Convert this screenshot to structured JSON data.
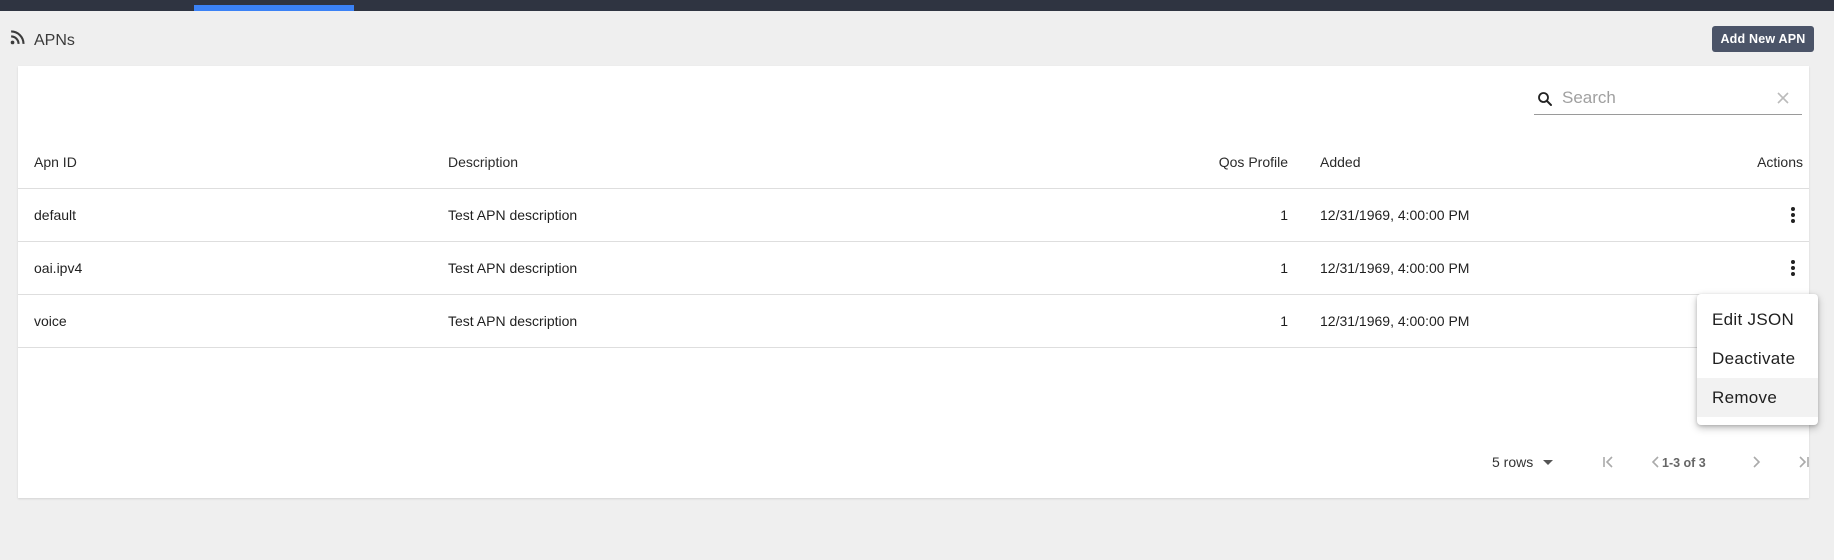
{
  "header": {
    "title": "APNs",
    "add_button": "Add New APN"
  },
  "search": {
    "placeholder": "Search"
  },
  "table": {
    "columns": [
      "Apn ID",
      "Description",
      "Qos Profile",
      "Added",
      "Actions"
    ],
    "rows": [
      {
        "id": "default",
        "description": "Test APN description",
        "qos": "1",
        "added": "12/31/1969, 4:00:00 PM"
      },
      {
        "id": "oai.ipv4",
        "description": "Test APN description",
        "qos": "1",
        "added": "12/31/1969, 4:00:00 PM"
      },
      {
        "id": "voice",
        "description": "Test APN description",
        "qos": "1",
        "added": "12/31/1969, 4:00:00 PM"
      }
    ]
  },
  "pagination": {
    "rows_per_page": "5 rows",
    "range": "1-3 of 3"
  },
  "menu": {
    "items": [
      "Edit JSON",
      "Deactivate",
      "Remove"
    ],
    "highlighted": "Remove"
  },
  "colors": {
    "topbar": "#2f3441",
    "tab_indicator": "#3b82f6",
    "button": "#4b5468"
  }
}
